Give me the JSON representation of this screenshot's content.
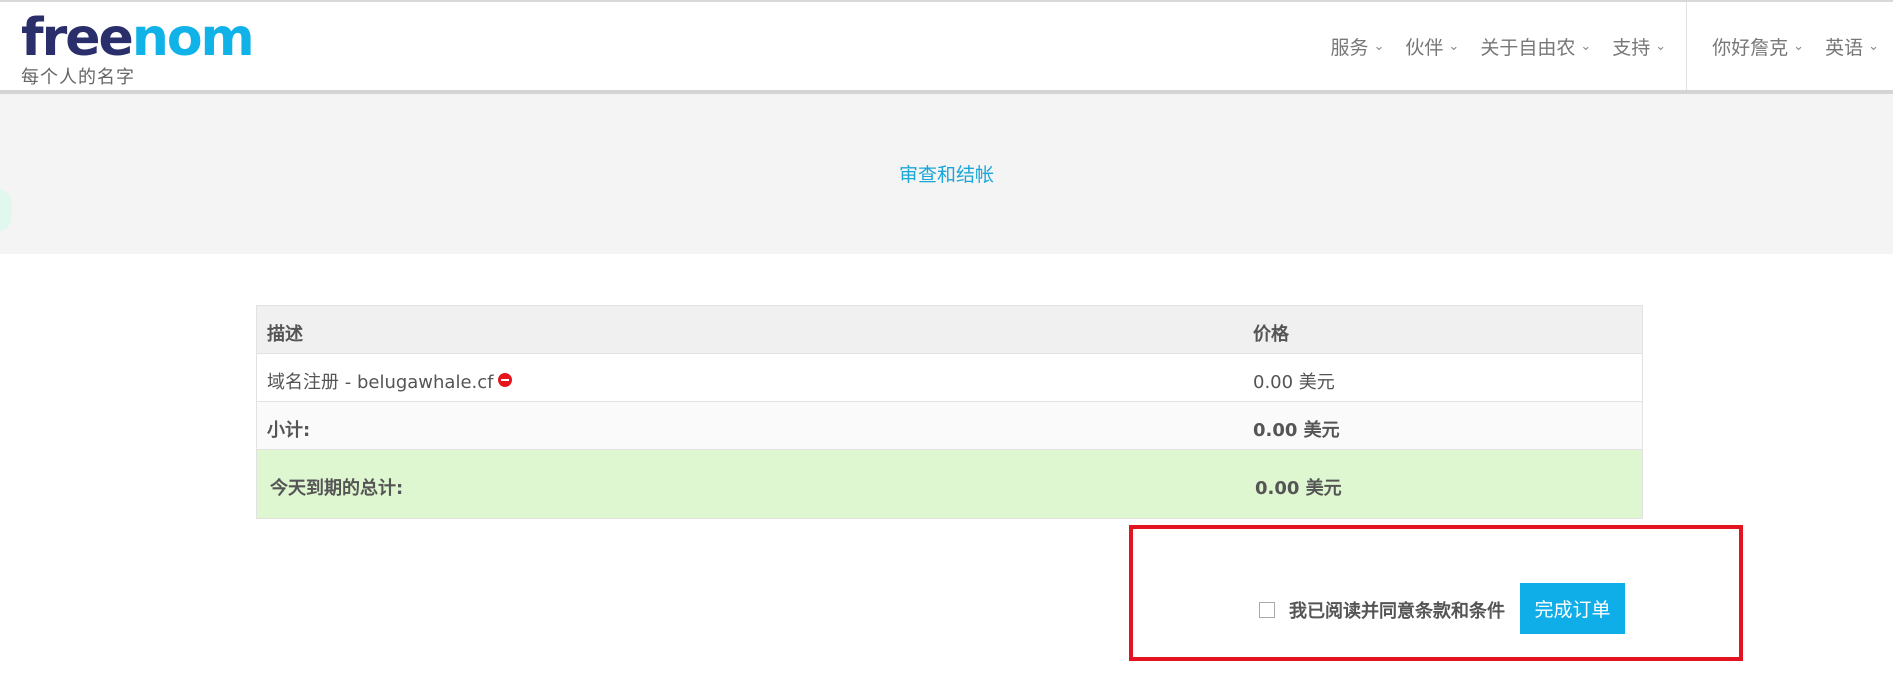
{
  "header": {
    "logo_part_a": "free",
    "logo_part_b": "nom",
    "tagline": "每个人的名字",
    "nav": [
      {
        "label": "服务"
      },
      {
        "label": "伙伴"
      },
      {
        "label": "关于自由农"
      },
      {
        "label": "支持"
      }
    ],
    "account": {
      "label": "你好詹克"
    },
    "language": {
      "label": "英语"
    }
  },
  "banner": {
    "title": "审查和结帐"
  },
  "cart": {
    "headers": {
      "description": "描述",
      "price": "价格"
    },
    "items": [
      {
        "description": "域名注册 - belugawhale.cf",
        "price": "0.00 美元",
        "remove_icon": "remove-icon"
      }
    ],
    "subtotal": {
      "label": "小计:",
      "value": "0.00 美元"
    },
    "total_due_today": {
      "label": "今天到期的总计:",
      "value": "0.00 美元"
    }
  },
  "checkout": {
    "agree_label": "我已阅读并同意条款和条件",
    "agree_checked": false,
    "complete_button": "完成订单"
  },
  "colors": {
    "accent": "#10aee8",
    "brand_dark": "#2a2f6b",
    "total_row_bg": "#dff7d1",
    "highlight_border": "#e3141f"
  }
}
